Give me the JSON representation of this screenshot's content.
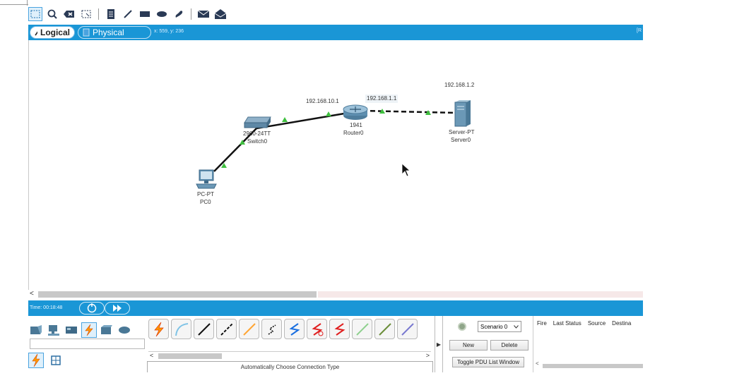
{
  "toolbar": {
    "items": [
      "select-icon",
      "inspect-icon",
      "delete-icon",
      "resize-icon",
      "note-icon",
      "draw-line-icon",
      "rectangle-icon",
      "ellipse-icon",
      "freeform-icon",
      "add-simple-pdu-icon",
      "add-complex-pdu-icon"
    ]
  },
  "tabs": {
    "logical": "Logical",
    "physical": "Physical",
    "coords": "x: 559, y: 236",
    "right_text": "[R"
  },
  "topology": {
    "ip_router_g0": "192.168.10.1",
    "ip_router_g1": "192.168.1.1",
    "ip_server": "192.168.1.2",
    "switch_model": "2960-24TT",
    "switch_name": "Switch0",
    "router_model": "1941",
    "router_name": "Router0",
    "server_model": "Server-PT",
    "server_name": "Server0",
    "pc_model": "PC-PT",
    "pc_name": "PC0"
  },
  "scrollbar": {
    "left_arrow": "<"
  },
  "timebar": {
    "time": "Time: 00:18:48"
  },
  "bottom": {
    "connection_description": "Automatically Choose Connection Type",
    "scroll_left": "<",
    "scroll_right": ">",
    "split_arrow": "▶",
    "scenario": "Scenario 0",
    "new_label": "New",
    "delete_label": "Delete",
    "toggle_label": "Toggle PDU List Window",
    "pdu_headers": [
      "Fire",
      "Last Status",
      "Source",
      "Destina"
    ],
    "pdu_scroll_left": "<"
  },
  "colors": {
    "accent": "#1a96d6",
    "link_up": "#3fbf3f",
    "cable": "#111111"
  }
}
